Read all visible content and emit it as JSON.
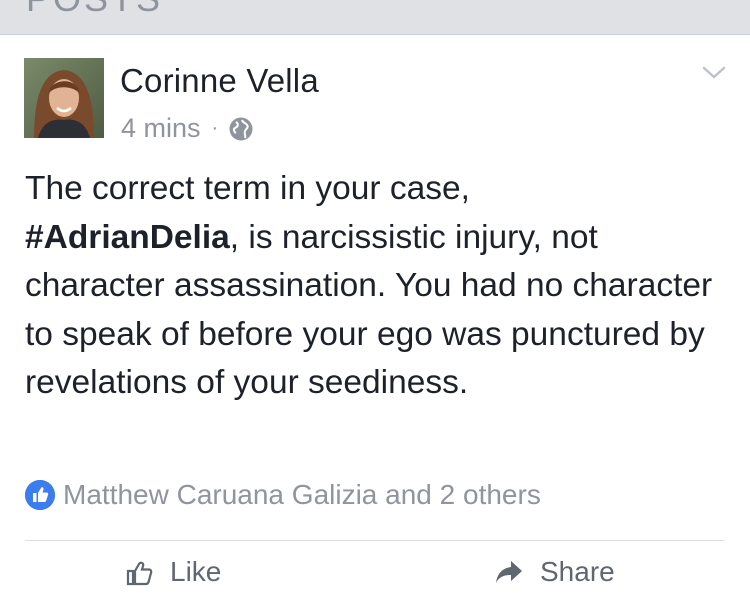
{
  "section": {
    "title": "POSTS"
  },
  "post": {
    "author": "Corinne Vella",
    "time": "4 mins",
    "separator": "·",
    "privacy_icon": "globe-icon",
    "menu_icon": "chevron-down-icon",
    "body": {
      "line1": "The correct term in your case,",
      "hashtag": "#AdrianDelia",
      "line2_rest": ", is narcissistic injury, not character assassination. You had no character to speak of before your ego was punctured by revelations of your seediness."
    },
    "reactions": {
      "icon": "thumbs-up-icon",
      "text": "Matthew Caruana Galizia and 2 others"
    },
    "actions": [
      {
        "label": "Like",
        "icon": "thumbs-up-icon"
      },
      {
        "label": "Share",
        "icon": "share-arrow-icon"
      }
    ]
  },
  "colors": {
    "header_bg": "#dfe1e5",
    "text": "#1d2129",
    "meta": "#90949c",
    "like_blue": "#3b7ded"
  }
}
